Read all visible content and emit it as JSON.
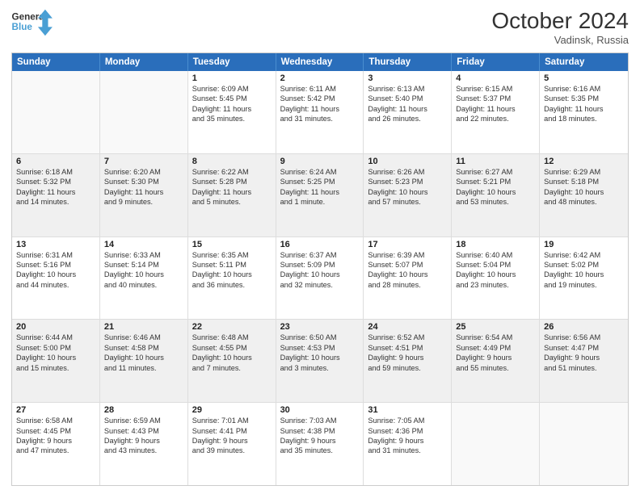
{
  "header": {
    "logo_line1": "General",
    "logo_line2": "Blue",
    "month": "October 2024",
    "location": "Vadinsk, Russia"
  },
  "days_of_week": [
    "Sunday",
    "Monday",
    "Tuesday",
    "Wednesday",
    "Thursday",
    "Friday",
    "Saturday"
  ],
  "rows": [
    [
      {
        "day": "",
        "info": [],
        "empty": true
      },
      {
        "day": "",
        "info": [],
        "empty": true
      },
      {
        "day": "1",
        "info": [
          "Sunrise: 6:09 AM",
          "Sunset: 5:45 PM",
          "Daylight: 11 hours",
          "and 35 minutes."
        ]
      },
      {
        "day": "2",
        "info": [
          "Sunrise: 6:11 AM",
          "Sunset: 5:42 PM",
          "Daylight: 11 hours",
          "and 31 minutes."
        ]
      },
      {
        "day": "3",
        "info": [
          "Sunrise: 6:13 AM",
          "Sunset: 5:40 PM",
          "Daylight: 11 hours",
          "and 26 minutes."
        ]
      },
      {
        "day": "4",
        "info": [
          "Sunrise: 6:15 AM",
          "Sunset: 5:37 PM",
          "Daylight: 11 hours",
          "and 22 minutes."
        ]
      },
      {
        "day": "5",
        "info": [
          "Sunrise: 6:16 AM",
          "Sunset: 5:35 PM",
          "Daylight: 11 hours",
          "and 18 minutes."
        ]
      }
    ],
    [
      {
        "day": "6",
        "info": [
          "Sunrise: 6:18 AM",
          "Sunset: 5:32 PM",
          "Daylight: 11 hours",
          "and 14 minutes."
        ],
        "shaded": true
      },
      {
        "day": "7",
        "info": [
          "Sunrise: 6:20 AM",
          "Sunset: 5:30 PM",
          "Daylight: 11 hours",
          "and 9 minutes."
        ],
        "shaded": true
      },
      {
        "day": "8",
        "info": [
          "Sunrise: 6:22 AM",
          "Sunset: 5:28 PM",
          "Daylight: 11 hours",
          "and 5 minutes."
        ],
        "shaded": true
      },
      {
        "day": "9",
        "info": [
          "Sunrise: 6:24 AM",
          "Sunset: 5:25 PM",
          "Daylight: 11 hours",
          "and 1 minute."
        ],
        "shaded": true
      },
      {
        "day": "10",
        "info": [
          "Sunrise: 6:26 AM",
          "Sunset: 5:23 PM",
          "Daylight: 10 hours",
          "and 57 minutes."
        ],
        "shaded": true
      },
      {
        "day": "11",
        "info": [
          "Sunrise: 6:27 AM",
          "Sunset: 5:21 PM",
          "Daylight: 10 hours",
          "and 53 minutes."
        ],
        "shaded": true
      },
      {
        "day": "12",
        "info": [
          "Sunrise: 6:29 AM",
          "Sunset: 5:18 PM",
          "Daylight: 10 hours",
          "and 48 minutes."
        ],
        "shaded": true
      }
    ],
    [
      {
        "day": "13",
        "info": [
          "Sunrise: 6:31 AM",
          "Sunset: 5:16 PM",
          "Daylight: 10 hours",
          "and 44 minutes."
        ]
      },
      {
        "day": "14",
        "info": [
          "Sunrise: 6:33 AM",
          "Sunset: 5:14 PM",
          "Daylight: 10 hours",
          "and 40 minutes."
        ]
      },
      {
        "day": "15",
        "info": [
          "Sunrise: 6:35 AM",
          "Sunset: 5:11 PM",
          "Daylight: 10 hours",
          "and 36 minutes."
        ]
      },
      {
        "day": "16",
        "info": [
          "Sunrise: 6:37 AM",
          "Sunset: 5:09 PM",
          "Daylight: 10 hours",
          "and 32 minutes."
        ]
      },
      {
        "day": "17",
        "info": [
          "Sunrise: 6:39 AM",
          "Sunset: 5:07 PM",
          "Daylight: 10 hours",
          "and 28 minutes."
        ]
      },
      {
        "day": "18",
        "info": [
          "Sunrise: 6:40 AM",
          "Sunset: 5:04 PM",
          "Daylight: 10 hours",
          "and 23 minutes."
        ]
      },
      {
        "day": "19",
        "info": [
          "Sunrise: 6:42 AM",
          "Sunset: 5:02 PM",
          "Daylight: 10 hours",
          "and 19 minutes."
        ]
      }
    ],
    [
      {
        "day": "20",
        "info": [
          "Sunrise: 6:44 AM",
          "Sunset: 5:00 PM",
          "Daylight: 10 hours",
          "and 15 minutes."
        ],
        "shaded": true
      },
      {
        "day": "21",
        "info": [
          "Sunrise: 6:46 AM",
          "Sunset: 4:58 PM",
          "Daylight: 10 hours",
          "and 11 minutes."
        ],
        "shaded": true
      },
      {
        "day": "22",
        "info": [
          "Sunrise: 6:48 AM",
          "Sunset: 4:55 PM",
          "Daylight: 10 hours",
          "and 7 minutes."
        ],
        "shaded": true
      },
      {
        "day": "23",
        "info": [
          "Sunrise: 6:50 AM",
          "Sunset: 4:53 PM",
          "Daylight: 10 hours",
          "and 3 minutes."
        ],
        "shaded": true
      },
      {
        "day": "24",
        "info": [
          "Sunrise: 6:52 AM",
          "Sunset: 4:51 PM",
          "Daylight: 9 hours",
          "and 59 minutes."
        ],
        "shaded": true
      },
      {
        "day": "25",
        "info": [
          "Sunrise: 6:54 AM",
          "Sunset: 4:49 PM",
          "Daylight: 9 hours",
          "and 55 minutes."
        ],
        "shaded": true
      },
      {
        "day": "26",
        "info": [
          "Sunrise: 6:56 AM",
          "Sunset: 4:47 PM",
          "Daylight: 9 hours",
          "and 51 minutes."
        ],
        "shaded": true
      }
    ],
    [
      {
        "day": "27",
        "info": [
          "Sunrise: 6:58 AM",
          "Sunset: 4:45 PM",
          "Daylight: 9 hours",
          "and 47 minutes."
        ]
      },
      {
        "day": "28",
        "info": [
          "Sunrise: 6:59 AM",
          "Sunset: 4:43 PM",
          "Daylight: 9 hours",
          "and 43 minutes."
        ]
      },
      {
        "day": "29",
        "info": [
          "Sunrise: 7:01 AM",
          "Sunset: 4:41 PM",
          "Daylight: 9 hours",
          "and 39 minutes."
        ]
      },
      {
        "day": "30",
        "info": [
          "Sunrise: 7:03 AM",
          "Sunset: 4:38 PM",
          "Daylight: 9 hours",
          "and 35 minutes."
        ]
      },
      {
        "day": "31",
        "info": [
          "Sunrise: 7:05 AM",
          "Sunset: 4:36 PM",
          "Daylight: 9 hours",
          "and 31 minutes."
        ]
      },
      {
        "day": "",
        "info": [],
        "empty": true
      },
      {
        "day": "",
        "info": [],
        "empty": true
      }
    ]
  ]
}
